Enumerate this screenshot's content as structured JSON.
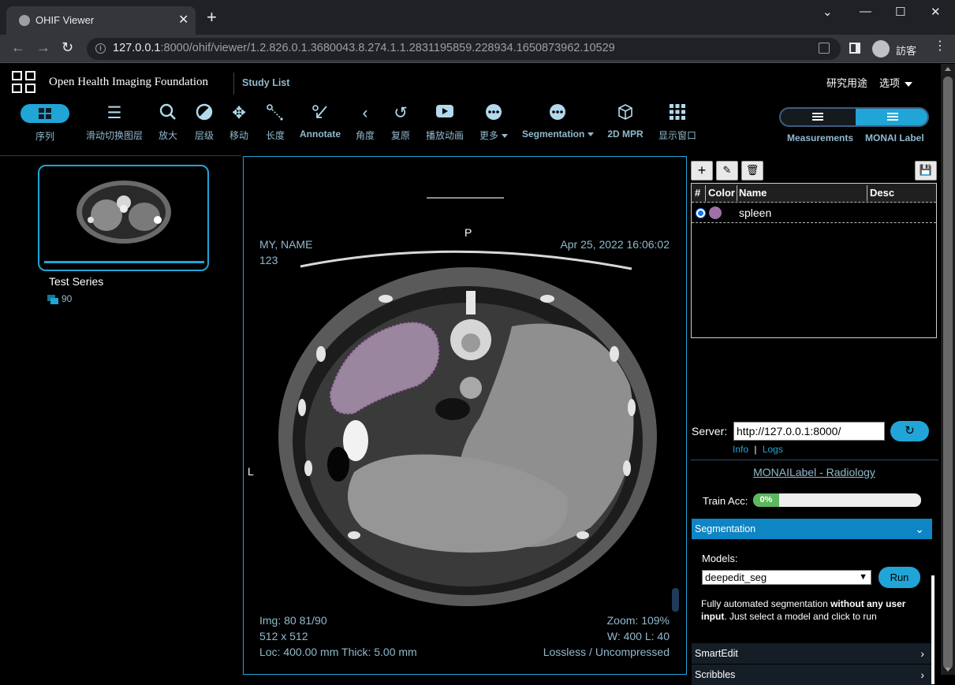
{
  "browser": {
    "tab_title": "OHIF Viewer",
    "new_tab_label": "+",
    "url_host": "127.0.0.1",
    "url_rest": ":8000/ohif/viewer/1.2.826.0.1.3680043.8.274.1.1.2831195859.228934.1650873962.10529",
    "profile_label": "訪客"
  },
  "header": {
    "brand": "Open Health Imaging Foundation",
    "study_list": "Study List",
    "research_use": "研究用途",
    "options": "选项"
  },
  "toolbar": {
    "series": "序列",
    "stack_scroll": "滑动切换图层",
    "zoom": "放大",
    "levels": "层级",
    "pan": "移动",
    "length": "长度",
    "annotate": "Annotate",
    "angle": "角度",
    "reset": "复原",
    "cine": "播放动画",
    "more": "更多",
    "segmentation": "Segmentation",
    "mpr": "2D MPR",
    "layout": "显示窗口",
    "measurements": "Measurements",
    "monai_label": "MONAI Label"
  },
  "study_panel": {
    "series_description": "Test Series",
    "instance_count": "90"
  },
  "viewport": {
    "patient_name": "MY, NAME",
    "patient_id": "123",
    "study_date": "Apr 25, 2022 16:06:02",
    "orientation_top": "P",
    "orientation_left": "L",
    "image_index": "Img: 80 81/90",
    "dimensions": "512 x 512",
    "location": "Loc: 400.00 mm Thick: 5.00 mm",
    "zoom": "Zoom: 109%",
    "window_level": "W: 400 L: 40",
    "compression": "Lossless / Uncompressed"
  },
  "monai": {
    "seg_table_headers": [
      "#",
      "Color",
      "Name",
      "Desc"
    ],
    "segments": [
      {
        "name": "spleen",
        "color": "#a070a8"
      }
    ],
    "server_label": "Server:",
    "server_url": "http://127.0.0.1:8000/",
    "info_link": "Info",
    "logs_link": "Logs",
    "link_separator": "|",
    "app_title": "MONAILabel - Radiology",
    "train_acc_label": "Train Acc:",
    "train_acc_value": "0%",
    "train_acc_fraction": 0.0,
    "segmentation_header": "Segmentation",
    "models_label": "Models:",
    "model_selected": "deepedit_seg",
    "run_button": "Run",
    "desc_part1": "Fully automated segmentation ",
    "desc_bold": "without any user input",
    "desc_part2": ". Just select a model and click to run",
    "smartedit_header": "SmartEdit",
    "scribbles_header": "Scribbles"
  },
  "colors": {
    "accent": "#20a5d6",
    "text_secondary": "#91b9cd",
    "segment_spleen": "#a070a8"
  }
}
